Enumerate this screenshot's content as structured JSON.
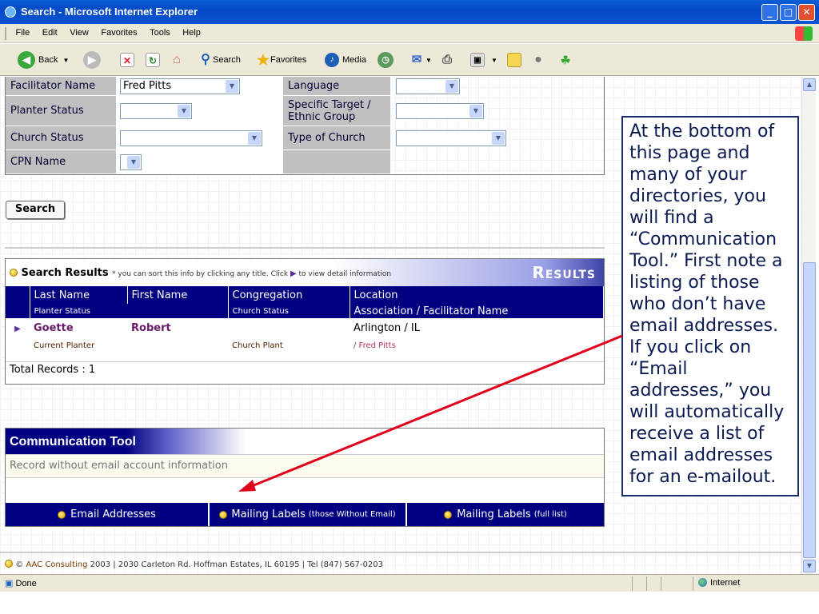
{
  "window": {
    "title": "Search - Microsoft Internet Explorer"
  },
  "menu": [
    "File",
    "Edit",
    "View",
    "Favorites",
    "Tools",
    "Help"
  ],
  "toolbar": {
    "back": "Back",
    "search": "Search",
    "favorites": "Favorites",
    "media": "Media"
  },
  "form": {
    "facilitator_label": "Facilitator Name",
    "facilitator_value": "Fred Pitts",
    "language_label": "Language",
    "language_value": "",
    "planter_status_label": "Planter Status",
    "planter_status_value": "",
    "target_label": "Specific Target / Ethnic Group",
    "target_value": "",
    "church_status_label": "Church Status",
    "church_status_value": "",
    "church_type_label": "Type of Church",
    "church_type_value": "",
    "cpn_label": "CPN Name",
    "cpn_value": "",
    "search_button": "Search"
  },
  "results": {
    "title": "Search Results",
    "note_star": " * ",
    "note_text1": "you can sort this info by clicking any title. Click",
    "note_text2": "to view detail information",
    "banner": "Results",
    "headers": [
      "Last Name",
      "First Name",
      "Congregation",
      "Location"
    ],
    "subheaders": [
      "Planter Status",
      "Church Status",
      "Association / Facilitator Name"
    ],
    "row": {
      "last_name": "Goette",
      "first_name": "Robert",
      "congregation": "",
      "location": "Arlington / IL",
      "planter_status": "Current Planter",
      "church_status": "Church Plant",
      "facilitator": "/ Fred Pitts"
    },
    "total": "Total Records : 1"
  },
  "communication": {
    "title": "Communication Tool",
    "record_text": "Record without email account information",
    "btn_email": "Email Addresses",
    "btn_labels_no_email": "Mailing Labels",
    "btn_labels_no_email_note": "(those Without Email)",
    "btn_labels_full": "Mailing Labels",
    "btn_labels_full_note": "(full list)"
  },
  "footer": {
    "copyright": "©",
    "company": "AAC Consulting",
    "rest": " 2003 | 2030 Carleton Rd. Hoffman Estates, IL 60195 | Tel  (847) 567-0203"
  },
  "callout": "At the bottom of this page and many of your directories, you will find a “Communication Tool.”  First note a listing of those who don’t have email addresses.  If you click on “Email addresses,” you will automatically receive a list of email addresses for an e-mailout.",
  "status": {
    "left": "Done",
    "zone": "Internet"
  },
  "colors": {
    "nav_blue": "#000080",
    "arrow_red": "#e0001b",
    "title_blue": "#0349c4"
  }
}
